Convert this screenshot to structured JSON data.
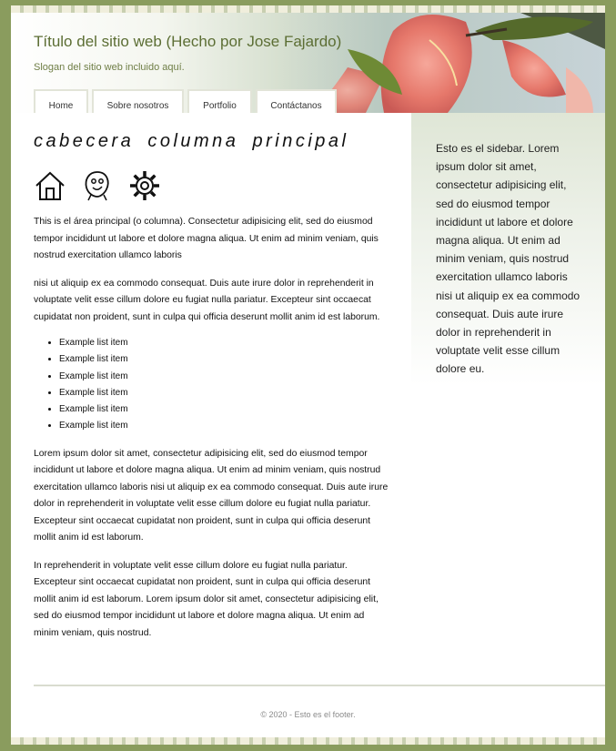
{
  "header": {
    "site_title": "Título del sitio web (Hecho por Jose Fajardo)",
    "slogan": "Slogan del sitio web incluido aquí."
  },
  "nav": {
    "items": [
      {
        "label": "Home"
      },
      {
        "label": "Sobre nosotros"
      },
      {
        "label": "Portfolio"
      },
      {
        "label": "Contáctanos"
      }
    ]
  },
  "main": {
    "heading": "cabecera columna principal",
    "icons": [
      "home-icon",
      "face-icon",
      "gear-icon"
    ],
    "paragraphs": [
      "This is el área principal (o columna). Consectetur adipisicing elit, sed do eiusmod tempor incididunt ut labore et dolore magna aliqua. Ut enim ad minim veniam, quis nostrud exercitation ullamco laboris",
      "nisi ut aliquip ex ea commodo consequat. Duis aute irure dolor in reprehenderit in voluptate velit esse cillum dolore eu fugiat nulla pariatur. Excepteur sint occaecat cupidatat non proident, sunt in culpa qui officia deserunt mollit anim id est laborum.",
      "Lorem ipsum dolor sit amet, consectetur adipisicing elit, sed do eiusmod tempor incididunt ut labore et dolore magna aliqua. Ut enim ad minim veniam, quis nostrud exercitation ullamco laboris nisi ut aliquip ex ea commodo consequat. Duis aute irure dolor in reprehenderit in voluptate velit esse cillum dolore eu fugiat nulla pariatur. Excepteur sint occaecat cupidatat non proident, sunt in culpa qui officia deserunt mollit anim id est laborum.",
      "In reprehenderit in voluptate velit esse cillum dolore eu fugiat nulla pariatur. Excepteur sint occaecat cupidatat non proident, sunt in culpa qui officia deserunt mollit anim id est laborum. Lorem ipsum dolor sit amet, consectetur adipisicing elit, sed do eiusmod tempor incididunt ut labore et dolore magna aliqua. Ut enim ad minim veniam, quis nostrud."
    ],
    "list_items": [
      "Example list item",
      "Example list item",
      "Example list item",
      "Example list item",
      "Example list item",
      "Example list item"
    ]
  },
  "sidebar": {
    "text": "Esto es el sidebar. Lorem ipsum dolor sit amet, consectetur adipisicing elit, sed do eiusmod tempor incididunt ut labore et dolore magna aliqua. Ut enim ad minim veniam, quis nostrud exercitation ullamco laboris nisi ut aliquip ex ea commodo consequat. Duis aute irure dolor in reprehenderit in voluptate velit esse cillum dolore eu."
  },
  "footer": {
    "text": "© 2020 - Esto es el footer."
  },
  "colors": {
    "frame": "#8a9c5e",
    "title": "#5c6e34",
    "stripe_light": "#f0eedc",
    "stripe_dark": "#c8cfb0"
  }
}
